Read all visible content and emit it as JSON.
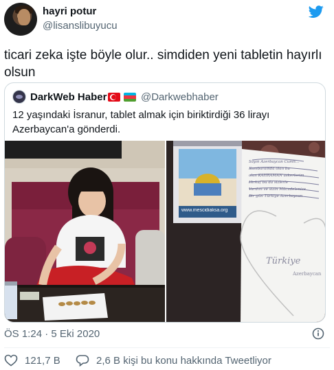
{
  "author": {
    "name": "hayri potur",
    "handle": "@lisanslibuyucu"
  },
  "tweet": {
    "text": "ticari zeka işte böyle olur.. simdiden yeni tabletin hayırlı olsun"
  },
  "quoted": {
    "name": "DarkWeb Haber",
    "handle": "@Darkwebhaber",
    "text": "12 yaşındaki İsranur, tablet almak için biriktirdiği 36 lirayı Azerbaycan'a gönderdi.",
    "flags": [
      "turkey-flag",
      "azerbaijan-flag"
    ]
  },
  "media": {
    "left": {
      "description_icon": "photo-girl-counting-coins"
    },
    "right": {
      "can_url": "www.mescidiaksa.org",
      "paper_lines": [
        "Sayın Azerbaycan Cumh...",
        "Kumbaramda olan bu",
        "olan KAHRAMAN askerlerim",
        "Hirkaf bu da sizlerle",
        "Vardım ve sizin Mücadelenize",
        "Bir gün Türkiye Azerbaycan"
      ],
      "heart_label": "Türkiye",
      "heart_label2": "Azerbaycan"
    }
  },
  "meta": {
    "timestamp": "ÖS 1:24 · 5 Eki 2020",
    "likes": "121,7 B",
    "talking": "2,6 B kişi bu konu hakkında Tweetliyor"
  },
  "colors": {
    "twitter_blue": "#1d9bf0",
    "secondary_text": "#536471",
    "border": "#cfd9de"
  }
}
